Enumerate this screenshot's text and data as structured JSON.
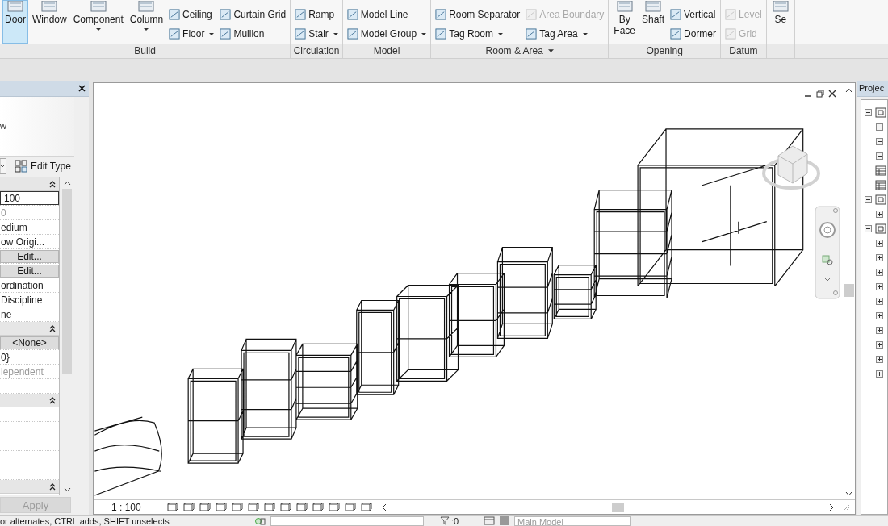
{
  "ribbon": {
    "panels": [
      {
        "label": "Build",
        "dropdown": false,
        "tools": [
          {
            "kind": "large",
            "label": "Door",
            "selected": true,
            "dropdown": false,
            "disabled": false
          },
          {
            "kind": "large",
            "label": "Window",
            "selected": false,
            "dropdown": false,
            "disabled": false
          },
          {
            "kind": "large",
            "label": "Component",
            "selected": false,
            "dropdown": true,
            "disabled": false
          },
          {
            "kind": "large",
            "label": "Column",
            "selected": false,
            "dropdown": true,
            "disabled": false
          },
          {
            "kind": "small",
            "label": "Ceiling",
            "selected": false,
            "dropdown": false,
            "disabled": false
          },
          {
            "kind": "small",
            "label": "Floor",
            "selected": false,
            "dropdown": true,
            "disabled": false
          },
          {
            "kind": "small",
            "label": "Curtain Grid",
            "selected": false,
            "dropdown": false,
            "disabled": false
          },
          {
            "kind": "small",
            "label": "Mullion",
            "selected": false,
            "dropdown": false,
            "disabled": false
          }
        ]
      },
      {
        "label": "Circulation",
        "dropdown": false,
        "tools": [
          {
            "kind": "small",
            "label": "Ramp",
            "selected": false,
            "dropdown": false,
            "disabled": false
          },
          {
            "kind": "small",
            "label": "Stair",
            "selected": false,
            "dropdown": true,
            "disabled": false
          }
        ]
      },
      {
        "label": "Model",
        "dropdown": false,
        "tools": [
          {
            "kind": "small",
            "label": "Model Line",
            "selected": false,
            "dropdown": false,
            "disabled": false
          },
          {
            "kind": "small",
            "label": "Model Group",
            "selected": false,
            "dropdown": true,
            "disabled": false
          }
        ]
      },
      {
        "label": "Room & Area",
        "dropdown": true,
        "tools": [
          {
            "kind": "small",
            "label": "Room Separator",
            "selected": false,
            "dropdown": false,
            "disabled": false
          },
          {
            "kind": "small",
            "label": "Tag Room",
            "selected": false,
            "dropdown": true,
            "disabled": false
          },
          {
            "kind": "small",
            "label": "Area Boundary",
            "selected": false,
            "dropdown": false,
            "disabled": true
          },
          {
            "kind": "small",
            "label": "Tag Area",
            "selected": false,
            "dropdown": true,
            "disabled": false
          }
        ]
      },
      {
        "label": "Opening",
        "dropdown": false,
        "tools": [
          {
            "kind": "large",
            "label": "By Face",
            "selected": false,
            "dropdown": false,
            "disabled": false
          },
          {
            "kind": "large",
            "label": "Shaft",
            "selected": false,
            "dropdown": false,
            "disabled": false
          },
          {
            "kind": "small",
            "label": "Vertical",
            "selected": false,
            "dropdown": false,
            "disabled": false
          },
          {
            "kind": "small",
            "label": "Dormer",
            "selected": false,
            "dropdown": false,
            "disabled": false
          }
        ]
      },
      {
        "label": "Datum",
        "dropdown": false,
        "tools": [
          {
            "kind": "small",
            "label": "Level",
            "selected": false,
            "dropdown": false,
            "disabled": true
          },
          {
            "kind": "small",
            "label": "Grid",
            "selected": false,
            "dropdown": false,
            "disabled": true
          }
        ]
      },
      {
        "tools": [
          {
            "kind": "large",
            "label": "Se",
            "selected": false,
            "dropdown": false,
            "disabled": false
          }
        ]
      }
    ]
  },
  "properties": {
    "type_name": "w",
    "edit_type": "Edit Type",
    "sections": [
      {
        "expanded": true,
        "rows": [
          {
            "kind": "field",
            "value": "100",
            "disabled": false
          },
          {
            "kind": "text",
            "value": "0",
            "disabled": true
          },
          {
            "kind": "text",
            "value": "edium",
            "disabled": false
          },
          {
            "kind": "text",
            "value": "ow Origi...",
            "disabled": false
          },
          {
            "kind": "button",
            "value": "Edit...",
            "disabled": false
          },
          {
            "kind": "button",
            "value": "Edit...",
            "disabled": false
          },
          {
            "kind": "text",
            "value": "ordination",
            "disabled": false
          },
          {
            "kind": "text",
            "value": "Discipline",
            "disabled": false
          },
          {
            "kind": "text",
            "value": "ne",
            "disabled": false
          }
        ]
      },
      {
        "expanded": true,
        "rows": [
          {
            "kind": "button",
            "value": "<None>",
            "disabled": false
          },
          {
            "kind": "text",
            "value": "0}",
            "disabled": false
          },
          {
            "kind": "text",
            "value": "lependent",
            "disabled": true
          },
          {
            "kind": "empty"
          }
        ]
      },
      {
        "expanded": true,
        "rows": [
          {
            "kind": "empty"
          },
          {
            "kind": "empty"
          },
          {
            "kind": "empty"
          },
          {
            "kind": "empty"
          },
          {
            "kind": "empty"
          }
        ]
      },
      {
        "expanded": true
      }
    ],
    "apply": {
      "label": "Apply",
      "disabled": true
    }
  },
  "view": {
    "scale": "1 : 100"
  },
  "browser": {
    "title": "Projec",
    "tree": [
      {
        "kind": "folder",
        "expanded": true,
        "children": [
          {
            "kind": "folder",
            "expanded": true
          },
          {
            "kind": "folder",
            "expanded": true
          },
          {
            "kind": "folder",
            "expanded": true
          }
        ]
      },
      {
        "kind": "leaf"
      },
      {
        "kind": "leaf"
      },
      {
        "kind": "folder",
        "expanded": true,
        "children": [
          {
            "kind": "folder",
            "expanded": false
          }
        ]
      },
      {
        "kind": "folder",
        "expanded": true,
        "children": [
          {
            "kind": "folder",
            "expanded": false
          },
          {
            "kind": "folder",
            "expanded": false
          },
          {
            "kind": "folder",
            "expanded": false
          },
          {
            "kind": "folder",
            "expanded": false
          },
          {
            "kind": "folder",
            "expanded": false
          },
          {
            "kind": "folder",
            "expanded": false
          },
          {
            "kind": "folder",
            "expanded": false
          },
          {
            "kind": "folder",
            "expanded": false
          },
          {
            "kind": "folder",
            "expanded": false
          },
          {
            "kind": "folder",
            "expanded": false
          }
        ]
      }
    ]
  },
  "status_bar": {
    "hint": "or alternates, CTRL adds, SHIFT unselects",
    "selection_count": ":0",
    "model": "Main Model"
  }
}
